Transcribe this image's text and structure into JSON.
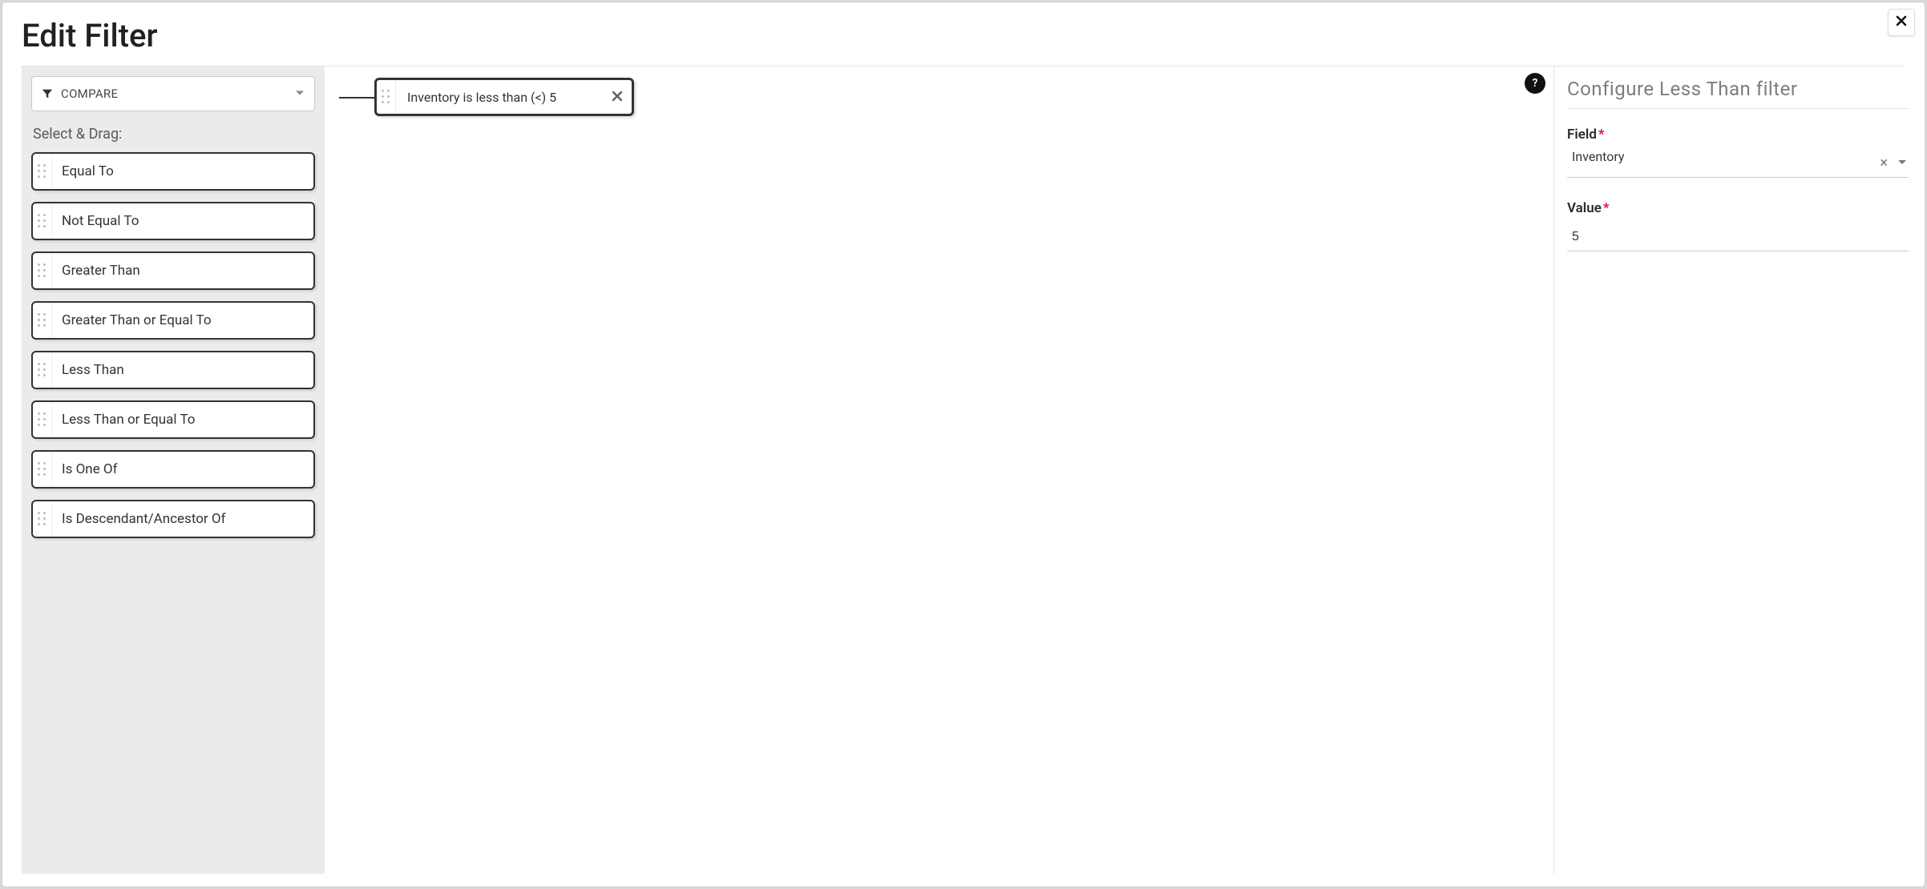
{
  "dialog": {
    "title": "Edit Filter"
  },
  "sidebar": {
    "category_label": "COMPARE",
    "select_drag_label": "Select & Drag:",
    "items": [
      {
        "label": "Equal To"
      },
      {
        "label": "Not Equal To"
      },
      {
        "label": "Greater Than"
      },
      {
        "label": "Greater Than or Equal To"
      },
      {
        "label": "Less Than"
      },
      {
        "label": "Less Than or Equal To"
      },
      {
        "label": "Is One Of"
      },
      {
        "label": "Is Descendant/Ancestor Of"
      }
    ]
  },
  "canvas": {
    "node_label": "Inventory is less than (<) 5",
    "help_label": "?"
  },
  "config": {
    "title": "Configure Less Than filter",
    "field_label": "Field",
    "field_value": "Inventory",
    "value_label": "Value",
    "value_value": "5"
  }
}
